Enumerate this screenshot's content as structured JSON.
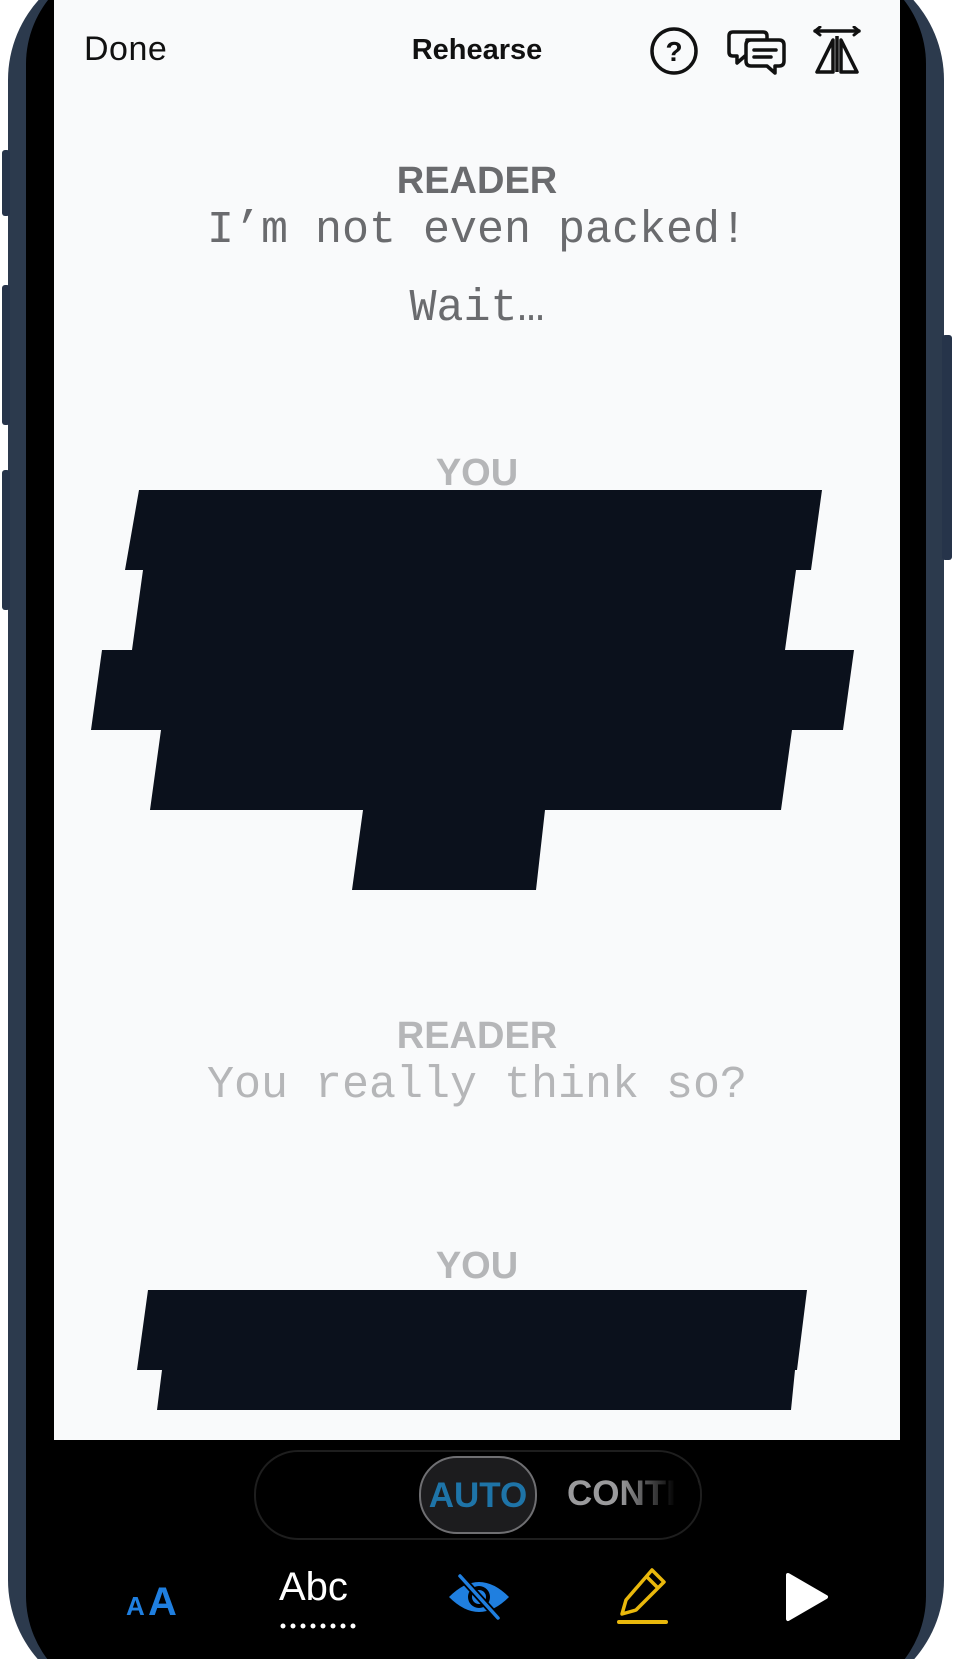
{
  "header": {
    "done_label": "Done",
    "title": "Rehearse",
    "icons": [
      "help-icon",
      "chat-bubbles-icon",
      "stage-icon"
    ]
  },
  "script": {
    "lines": [
      {
        "speaker": "READER",
        "text_1": "I’m not even packed!",
        "text_2": "Wait…"
      },
      {
        "speaker": "YOU",
        "hidden": true
      },
      {
        "speaker": "READER",
        "text_1": "You really think so?"
      },
      {
        "speaker": "YOU",
        "hidden": true
      }
    ]
  },
  "mode_selector": {
    "options": [
      "AUTO",
      "CONTIN"
    ],
    "selected": "AUTO"
  },
  "toolbar": {
    "text_size_icon": "text-size-icon",
    "abc_label": "Abc",
    "icons": [
      "text-size-icon",
      "spelling-icon",
      "hide-lines-icon",
      "highlight-pen-icon",
      "play-icon"
    ]
  },
  "colors": {
    "accent_blue": "#1e74a8",
    "icon_blue": "#1f7fe0",
    "highlight_yellow": "#e9b80c",
    "redaction": "#0b111c",
    "screen_bg": "#f9fafb",
    "phone_frame": "#2c3a4d"
  }
}
